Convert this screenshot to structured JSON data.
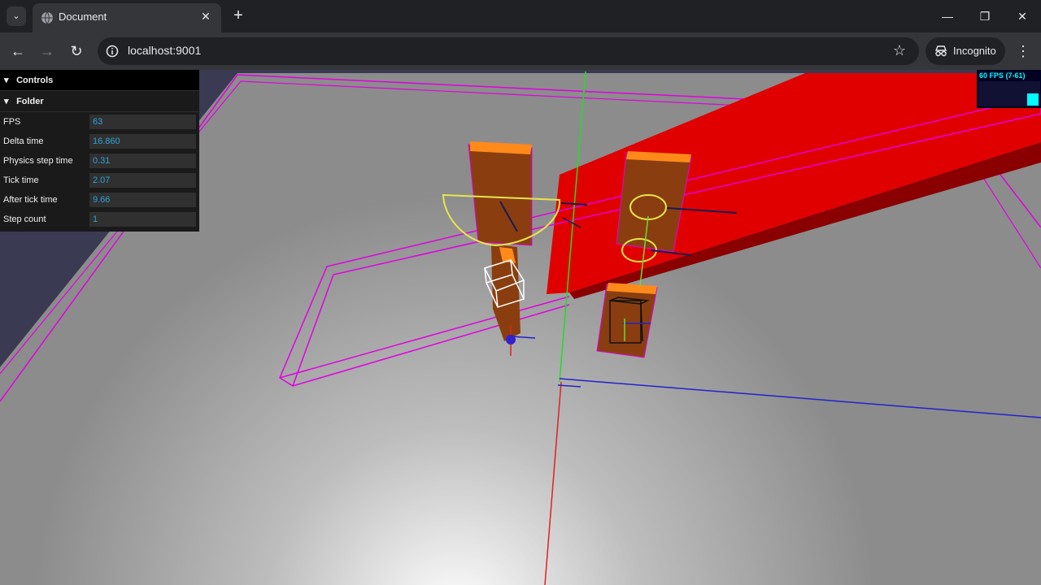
{
  "browser": {
    "tab_title": "Document",
    "url": "localhost:9001",
    "profile_label": "Incognito"
  },
  "gui": {
    "controls_title": "Controls",
    "folder_title": "Folder",
    "rows": [
      {
        "label": "FPS",
        "value": "63"
      },
      {
        "label": "Delta time",
        "value": "16.860"
      },
      {
        "label": "Physics step time",
        "value": "0.31"
      },
      {
        "label": "Tick time",
        "value": "2.07"
      },
      {
        "label": "After tick time",
        "value": "9.66"
      },
      {
        "label": "Step count",
        "value": "1"
      }
    ]
  },
  "stats": {
    "fps_text": "60 FPS (7-61)"
  },
  "colors": {
    "value_text": "#2fa1d6",
    "wireframe": "#e100e1",
    "red_beam": "#e00000",
    "box_fill": "#8a3e10",
    "box_top": "#ff8a1a"
  }
}
